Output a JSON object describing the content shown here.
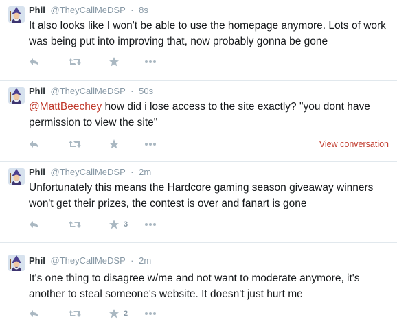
{
  "colors": {
    "link": "#c0392b",
    "muted": "#8899a6",
    "icon": "#aab8c2",
    "divider": "#e1e8ed"
  },
  "tweets": [
    {
      "name": "Phil",
      "handle": "@TheyCallMeDSP",
      "dot": "·",
      "time": "8s",
      "text": "It also looks like I won't be able to use the homepage anymore. Lots of work was being put into improving that, now probably gonna be gone",
      "mention": "",
      "favorites": "",
      "view_conversation": ""
    },
    {
      "name": "Phil",
      "handle": "@TheyCallMeDSP",
      "dot": "·",
      "time": "50s",
      "mention": "@MattBeechey",
      "text": " how did i lose access to the site exactly? \"you dont have permission to view the site\"",
      "favorites": "",
      "view_conversation": "View conversation"
    },
    {
      "name": "Phil",
      "handle": "@TheyCallMeDSP",
      "dot": "·",
      "time": "2m",
      "text": "Unfortunately this means the Hardcore gaming season giveaway winners won't get their prizes, the contest is over and fanart is gone",
      "mention": "",
      "favorites": "3",
      "view_conversation": ""
    },
    {
      "name": "Phil",
      "handle": "@TheyCallMeDSP",
      "dot": "·",
      "time": "2m",
      "text": "It's one thing to disagree w/me and not want to moderate anymore, it's another to steal someone's website. It doesn't just hurt me",
      "mention": "",
      "favorites": "2",
      "view_conversation": ""
    }
  ],
  "icons": {
    "reply": "reply-icon",
    "retweet": "retweet-icon",
    "favorite": "star-icon",
    "more": "more-icon",
    "avatar": "wizard-avatar"
  }
}
